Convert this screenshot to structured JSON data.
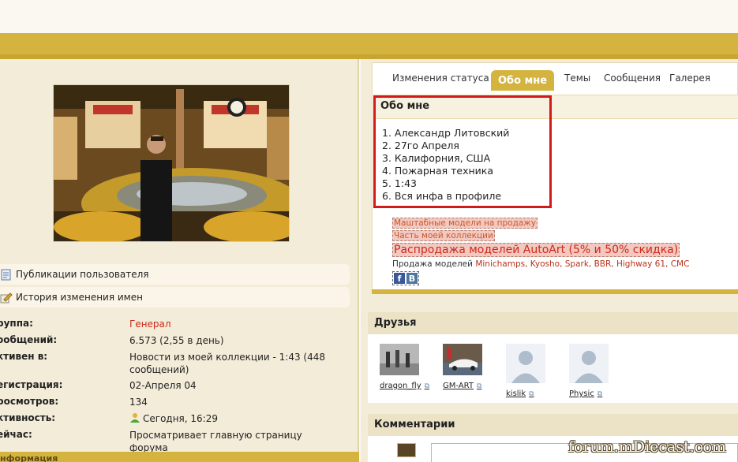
{
  "side_links": [
    {
      "label": "Публикации пользователя",
      "icon": "document-icon"
    },
    {
      "label": "История изменения имен",
      "icon": "pencil-icon"
    }
  ],
  "info": [
    {
      "key": "руппа:",
      "value": "Генерал"
    },
    {
      "key": "ообщений:",
      "value": "6.573 (2,55 в день)"
    },
    {
      "key": "ктивен в:",
      "value": "Новости из моей коллекции - 1:43 (448 сообщений)"
    },
    {
      "key": "егистрация:",
      "value": "02-Апреля 04"
    },
    {
      "key": "росмотров:",
      "value": "134"
    },
    {
      "key": "ктивность:",
      "value": "Сегодня, 16:29"
    },
    {
      "key": "ейчас:",
      "value": "Просматривает главную страницу форума"
    }
  ],
  "info_footer": "нформация",
  "tabs": [
    "Изменения статуса",
    "Обо мне",
    "Темы",
    "Сообщения",
    "Галерея"
  ],
  "about": {
    "title": "Обо мне",
    "items": [
      "1. Александр Литовский",
      "2. 27го Апреля",
      "3. Калифорния, США",
      "4. Пожарная техника",
      "5. 1:43",
      "6. Вся инфа в профиле"
    ]
  },
  "promo": {
    "link1": "Маштабные модели на продажу",
    "link2": "Часть моей коллекции",
    "big_pre": "Распродажа моделей ",
    "big_brand": "AutoArt",
    "big_post": " (5% и 50% скидка)",
    "sale_pre": "Продажа моделей ",
    "sale_brands": "Minichamps, Kyosho, Spark, BBR, Highway 61, CMC",
    "fb": "f",
    "vk": "B"
  },
  "friends_title": "Друзья",
  "friends": [
    {
      "name": "dragon_fly"
    },
    {
      "name": "GM-ART"
    },
    {
      "name": "kislik"
    },
    {
      "name": "Physic"
    }
  ],
  "comments_title": "Комментарии",
  "watermark": "forum.mDiecast.com",
  "colors": {
    "gold": "#d4b43e",
    "red_outline": "#d21a1a",
    "accent_red": "#cc2a18"
  }
}
